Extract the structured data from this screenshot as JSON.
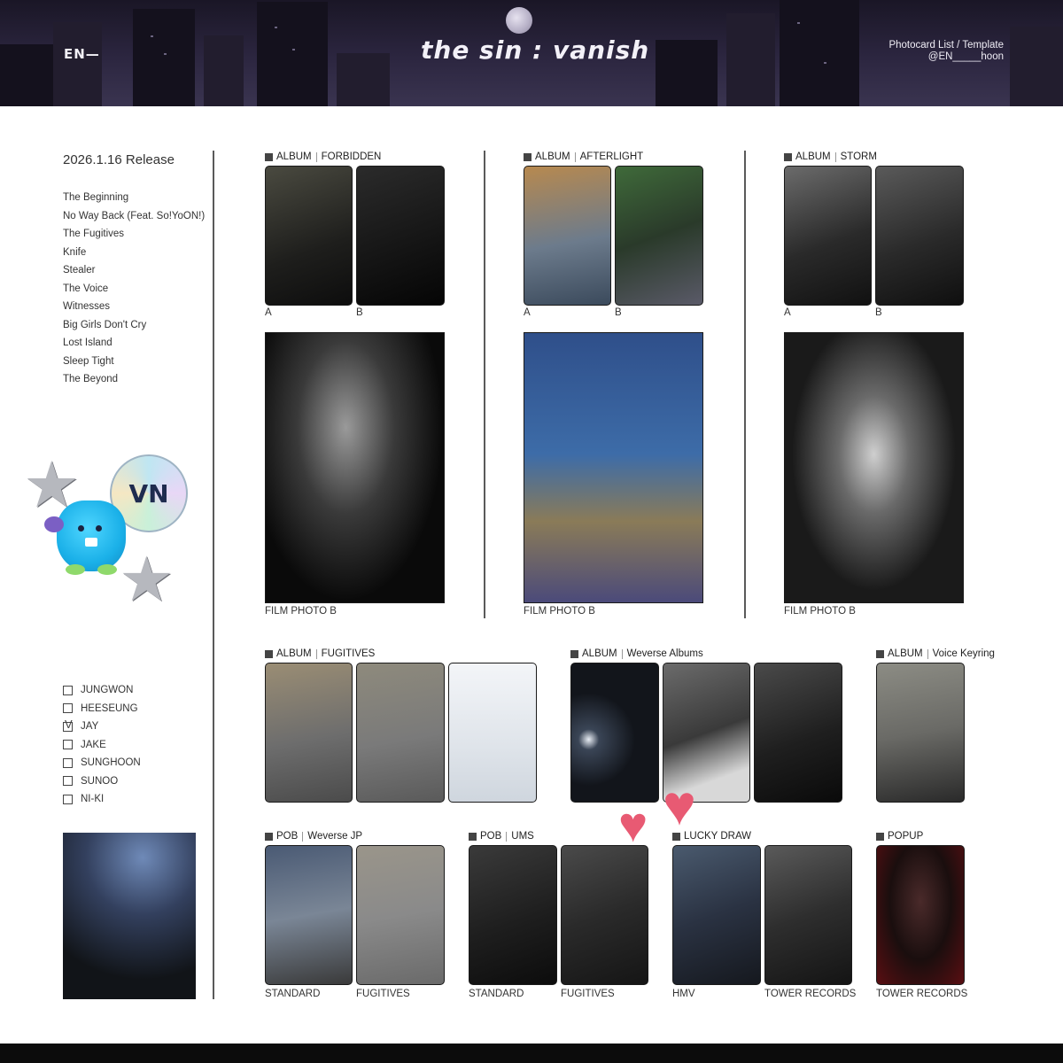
{
  "header": {
    "logo": "EN—",
    "album_title": "the sin : vanish",
    "subtitle": "Photocard List / Template",
    "credit": "@EN_____hoon"
  },
  "release": "2026.1.16 Release",
  "tracks": [
    "The Beginning",
    "No Way Back (Feat. So!YoON!)",
    "The Fugitives",
    "Knife",
    "Stealer",
    "The Voice",
    "Witnesses",
    "Big Girls Don't Cry",
    "Lost Island",
    "Sleep Tight",
    "The Beyond"
  ],
  "members": [
    {
      "name": "JUNGWON",
      "checked": false
    },
    {
      "name": "HEESEUNG",
      "checked": false
    },
    {
      "name": "JAY",
      "checked": true
    },
    {
      "name": "JAKE",
      "checked": false
    },
    {
      "name": "SUNGHOON",
      "checked": false
    },
    {
      "name": "SUNOO",
      "checked": false
    },
    {
      "name": "NI-KI",
      "checked": false
    }
  ],
  "stickers": {
    "seal_text": "VN",
    "star_glyph": "★"
  },
  "sections": {
    "forbidden": {
      "kind": "ALBUM",
      "name": "FORBIDDEN",
      "card_a": "A",
      "card_b": "B",
      "film": "FILM PHOTO B"
    },
    "afterlight": {
      "kind": "ALBUM",
      "name": "AFTERLIGHT",
      "card_a": "A",
      "card_b": "B",
      "film": "FILM PHOTO B"
    },
    "storm": {
      "kind": "ALBUM",
      "name": "STORM",
      "card_a": "A",
      "card_b": "B",
      "film": "FILM PHOTO B"
    },
    "fugitives": {
      "kind": "ALBUM",
      "name": "FUGITIVES"
    },
    "weverse_albums": {
      "kind": "ALBUM",
      "name": "Weverse Albums"
    },
    "voice_keyring": {
      "kind": "ALBUM",
      "name": "Voice Keyring"
    },
    "pob_weverse_jp": {
      "kind": "POB",
      "name": "Weverse JP",
      "card_1": "STANDARD",
      "card_2": "FUGITIVES"
    },
    "pob_ums": {
      "kind": "POB",
      "name": "UMS",
      "card_1": "STANDARD",
      "card_2": "FUGITIVES"
    },
    "lucky_draw": {
      "name": "LUCKY DRAW",
      "card_1": "HMV",
      "card_2": "TOWER RECORDS"
    },
    "popup": {
      "name": "POPUP",
      "card_1": "TOWER RECORDS"
    }
  },
  "colors": {
    "accent_heart": "#e85a73",
    "header_bg": "#2c2640"
  }
}
